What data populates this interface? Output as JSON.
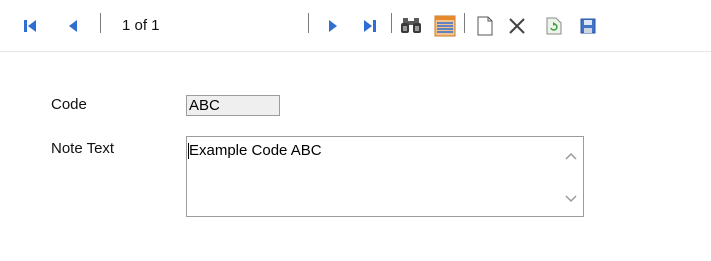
{
  "toolbar": {
    "counter": "1 of 1",
    "icons": [
      "first-record-icon",
      "previous-record-icon",
      "next-record-icon",
      "last-record-icon",
      "find-binoculars-icon",
      "list-view-icon",
      "new-record-icon",
      "delete-icon",
      "refresh-icon",
      "save-icon"
    ]
  },
  "form": {
    "code": {
      "label": "Code",
      "value": "ABC"
    },
    "note_text": {
      "label": "Note Text",
      "value": "Example Code ABC"
    }
  },
  "colors": {
    "nav_blue": "#2f6fd1",
    "label_text": "#111111",
    "readonly_field_bg": "#efefef",
    "field_border": "#9c9c9c",
    "list_icon_orange": "#e58a2c",
    "save_icon_blue": "#3f74c7"
  }
}
